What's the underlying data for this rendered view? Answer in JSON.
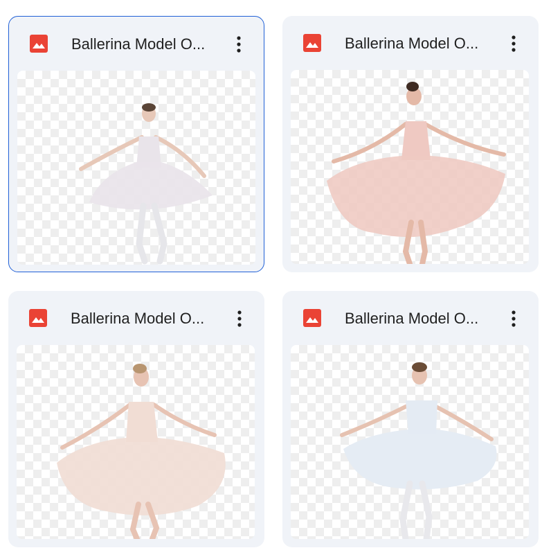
{
  "files": [
    {
      "title": "Ballerina Model O...",
      "selected": true,
      "icon": "image-file-icon",
      "menu_icon": "more-vert-icon",
      "dress_color": "#e9e4ea",
      "skin_color": "#e7c8b8"
    },
    {
      "title": "Ballerina Model O...",
      "selected": false,
      "icon": "image-file-icon",
      "menu_icon": "more-vert-icon",
      "dress_color": "#efc9c2",
      "skin_color": "#e4b9a7"
    },
    {
      "title": "Ballerina Model O...",
      "selected": false,
      "icon": "image-file-icon",
      "menu_icon": "more-vert-icon",
      "dress_color": "#f1ddd4",
      "skin_color": "#e7c3b3"
    },
    {
      "title": "Ballerina Model O...",
      "selected": false,
      "icon": "image-file-icon",
      "menu_icon": "more-vert-icon",
      "dress_color": "#e4ebf3",
      "skin_color": "#e6c2b1"
    }
  ],
  "colors": {
    "card_bg": "#f0f3f8",
    "selected_border": "#1f5fd6",
    "icon_red": "#ea4335",
    "text": "#1f1f1f"
  }
}
